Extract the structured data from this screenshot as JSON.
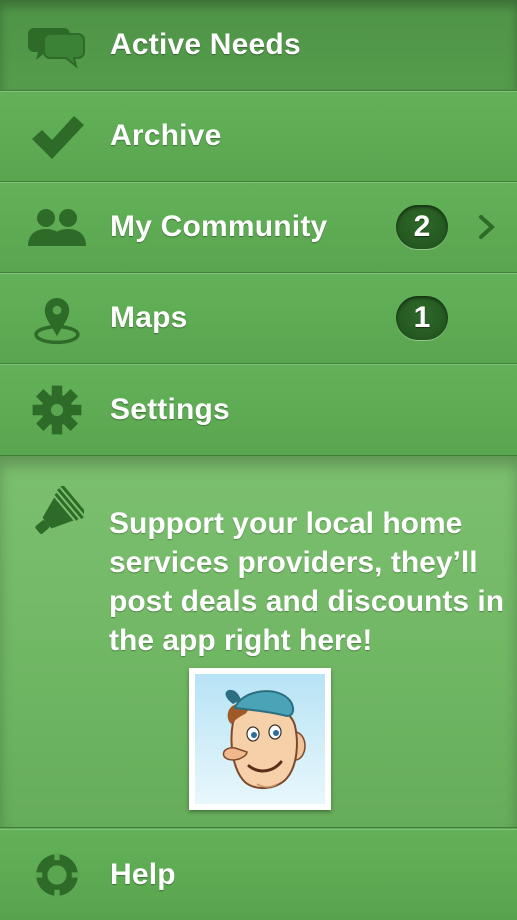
{
  "menu": {
    "items": [
      {
        "label": "Active Needs",
        "icon": "speech-bubbles-icon"
      },
      {
        "label": "Archive",
        "icon": "checkmark-icon"
      },
      {
        "label": "My Community",
        "icon": "people-icon",
        "badge": "2"
      },
      {
        "label": "Maps",
        "icon": "map-pin-icon",
        "badge": "1"
      },
      {
        "label": "Settings",
        "icon": "gear-icon"
      }
    ]
  },
  "promo": {
    "text": "Support your local home services providers, they’ll post deals and discounts in the app right here!",
    "icon": "megaphone-icon",
    "image": "mascot-handyman"
  },
  "help": {
    "label": "Help",
    "icon": "lifebuoy-icon"
  },
  "colors": {
    "background": "#5ea854",
    "active": "#4f9447",
    "promo": "#74b968",
    "badge": "#275c23"
  }
}
